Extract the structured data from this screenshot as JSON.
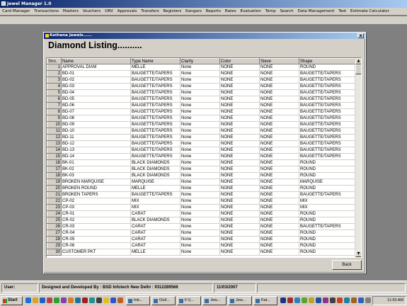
{
  "app": {
    "title": "Jewel Manager 1.0"
  },
  "menu": [
    "Card Manager",
    "Transactions",
    "Masters",
    "Vouchers",
    "ORV",
    "Approvals",
    "Transfers",
    "Registers",
    "Kangars",
    "Reports",
    "Rates",
    "Evaluation",
    "Temp",
    "Search",
    "Data Management",
    "Test",
    "Estimate Calculator"
  ],
  "dialog": {
    "title": "Kathana Jewels......",
    "heading": "Diamond Listing..........",
    "close": "x",
    "back_label": "Back",
    "columns": [
      "Sno.",
      "Name",
      "Type Name",
      "Clarity",
      "Color",
      "Sieve",
      "Shape"
    ],
    "rows": [
      [
        "1",
        "APPROVAL DIAM",
        "MELLE",
        "None",
        "NONE",
        "NONE",
        "ROUND"
      ],
      [
        "2",
        "BD-01",
        "BAUGETTE/TAPERS",
        "None",
        "NONE",
        "NONE",
        "BAUGETTE/TAPERS"
      ],
      [
        "3",
        "BD-02",
        "BAUGETTE/TAPERS",
        "None",
        "NONE",
        "NONE",
        "BAUGETTE/TAPERS"
      ],
      [
        "4",
        "BD-03",
        "BAUGETTE/TAPERS",
        "None",
        "NONE",
        "NONE",
        "BAUGETTE/TAPERS"
      ],
      [
        "5",
        "BD-04",
        "BAUGETTE/TAPERS",
        "None",
        "NONE",
        "NONE",
        "BAUGETTE/TAPERS"
      ],
      [
        "6",
        "BD-05",
        "BAUGETTE/TAPERS",
        "None",
        "NONE",
        "NONE",
        "BAUGETTE/TAPERS"
      ],
      [
        "7",
        "BD-06",
        "BAUGETTE/TAPERS",
        "None",
        "NONE",
        "NONE",
        "BAUGETTE/TAPERS"
      ],
      [
        "8",
        "BD-07",
        "BAUGETTE/TAPERS",
        "None",
        "NONE",
        "NONE",
        "BAUGETTE/TAPERS"
      ],
      [
        "9",
        "BD-08",
        "BAUGETTE/TAPERS",
        "None",
        "NONE",
        "NONE",
        "BAUGETTE/TAPERS"
      ],
      [
        "10",
        "BD-09",
        "BAUGETTE/TAPERS",
        "None",
        "NONE",
        "NONE",
        "BAUGETTE/TAPERS"
      ],
      [
        "11",
        "BD-10",
        "BAUGETTE/TAPERS",
        "None",
        "NONE",
        "NONE",
        "BAUGETTE/TAPERS"
      ],
      [
        "12",
        "BD-11",
        "BAUGETTE/TAPERS",
        "None",
        "NONE",
        "NONE",
        "BAUGETTE/TAPERS"
      ],
      [
        "13",
        "BD-12",
        "BAUGETTE/TAPERS",
        "None",
        "NONE",
        "NONE",
        "BAUGETTE/TAPERS"
      ],
      [
        "14",
        "BD-13",
        "BAUGETTE/TAPERS",
        "None",
        "NONE",
        "NONE",
        "BAUGETTE/TAPERS"
      ],
      [
        "15",
        "BD-14",
        "BAUGETTE/TAPERS",
        "None",
        "NONE",
        "NONE",
        "BAUGETTE/TAPERS"
      ],
      [
        "16",
        "BK-01",
        "BLACK DIAMONDS",
        "None",
        "NONE",
        "NONE",
        "ROUND"
      ],
      [
        "17",
        "BK-02",
        "BLACK DIAMONDS",
        "None",
        "NONE",
        "NONE",
        "ROUND"
      ],
      [
        "18",
        "BK-03",
        "BLACK DIAMONDS",
        "None",
        "NONE",
        "NONE",
        "ROUND"
      ],
      [
        "19",
        "BROKEN MARQUISE",
        "MARQUISE",
        "None",
        "NONE",
        "NONE",
        "MARQUISE"
      ],
      [
        "20",
        "BROKEN ROUND",
        "MELLE",
        "None",
        "NONE",
        "NONE",
        "ROUND"
      ],
      [
        "21",
        "BROKEN TAPERS",
        "BAUGETTE/TAPERS",
        "None",
        "NONE",
        "NONE",
        "BAUGETTE/TAPERS"
      ],
      [
        "22",
        "CP-02",
        "MIX",
        "None",
        "NONE",
        "NONE",
        "MIX"
      ],
      [
        "23",
        "CP-03",
        "MIX",
        "None",
        "NONE",
        "NONE",
        "MIX"
      ],
      [
        "24",
        "CR-01",
        "CARAT",
        "None",
        "NONE",
        "NONE",
        "ROUND"
      ],
      [
        "25",
        "CR-02",
        "BLACK DIAMONDS",
        "None",
        "NONE",
        "NONE",
        "ROUND"
      ],
      [
        "26",
        "CR-03",
        "CARAT",
        "None",
        "NONE",
        "NONE",
        "BAUGETTE/TAPERS"
      ],
      [
        "27",
        "CR-04",
        "CARAT",
        "None",
        "NONE",
        "NONE",
        "ROUND"
      ],
      [
        "28",
        "CR-05",
        "CARAT",
        "None",
        "NONE",
        "NONE",
        "ROUND"
      ],
      [
        "29",
        "CR-06",
        "CARAT",
        "None",
        "NONE",
        "NONE",
        "ROUND"
      ],
      [
        "30",
        "CUSTOMER PKT",
        "MELLE",
        "None",
        "NONE",
        "NONE",
        "ROUND"
      ]
    ]
  },
  "status": {
    "user": "User:",
    "developer": "Designed and Developed By : BSD Infotech New Delhi : 9312289566",
    "date": "11/03/2007"
  },
  "taskbar": {
    "start": "Start",
    "tasks": [
      "Inb...",
      "Outl...",
      "F:\\(...",
      "Jew...",
      "Jew...",
      "Kat..."
    ],
    "clock": "11:55 AM"
  },
  "colors": {
    "titlebar": "#0a246a",
    "face": "#d4d0c8",
    "desktop": "#808080"
  }
}
